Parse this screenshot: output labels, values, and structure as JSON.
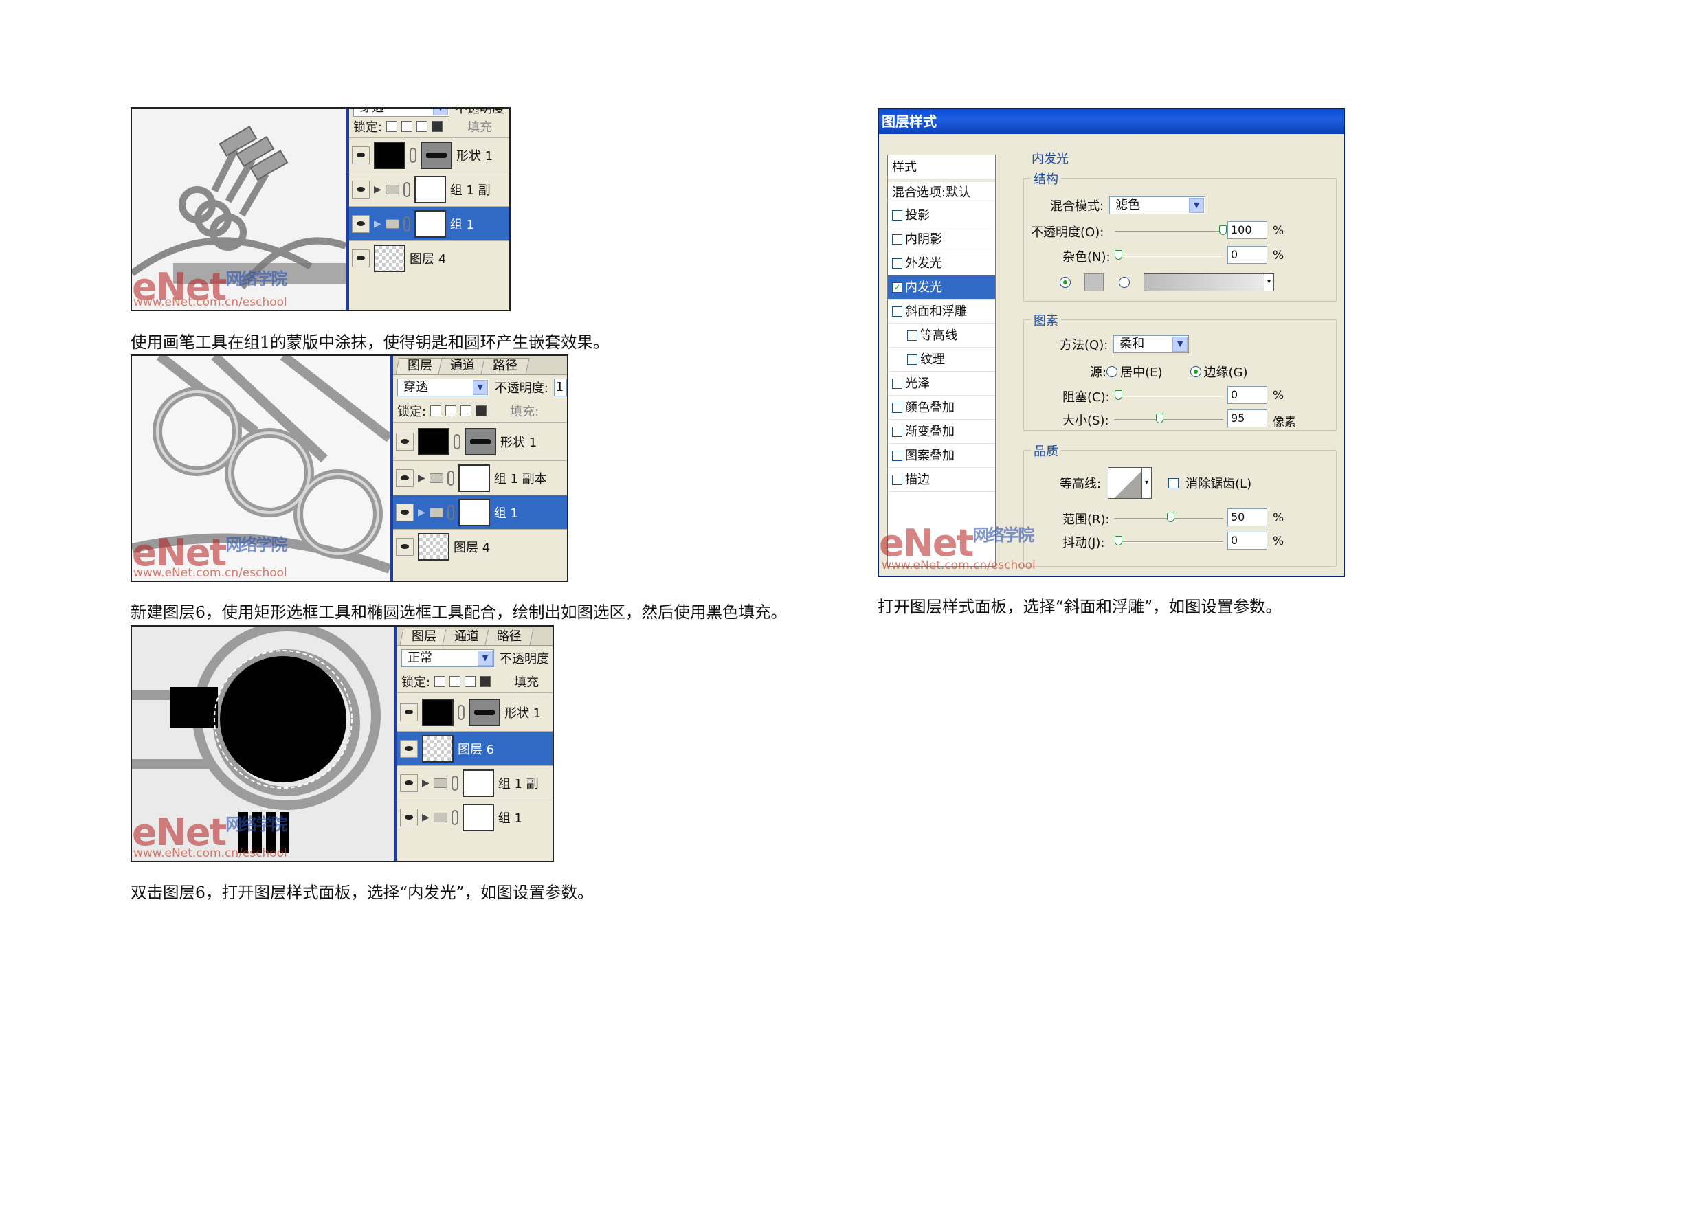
{
  "fig1": {
    "panel": {
      "blend_partial": "穿透",
      "opacity_partial": "不透明度",
      "lock_label": "锁定:",
      "fill_label": "填充",
      "layers": [
        "形状 1",
        "组 1 副",
        "组 1",
        "图层 4"
      ]
    }
  },
  "caption1": "使用画笔工具在组1的蒙版中涂抹，使得钥匙和圆环产生嵌套效果。",
  "fig2": {
    "tabs": [
      "图层",
      "通道",
      "路径"
    ],
    "blend": "穿透",
    "opacity_label": "不透明度:",
    "opacity_partial": "1",
    "lock_label": "锁定:",
    "fill_label": "填充:",
    "layers": [
      "形状 1",
      "组 1 副本",
      "组 1",
      "图层 4"
    ]
  },
  "caption2": "新建图层6，使用矩形选框工具和椭圆选框工具配合，绘制出如图选区，然后使用黑色填充。",
  "fig3": {
    "tabs": [
      "图层",
      "通道",
      "路径"
    ],
    "blend": "正常",
    "opacity_label": "不透明度",
    "lock_label": "锁定:",
    "fill_label": "填充",
    "layers": [
      "形状 1",
      "图层 6",
      "组 1 副",
      "组 1"
    ]
  },
  "caption3": "双击图层6，打开图层样式面板，选择“内发光”，如图设置参数。",
  "watermark": {
    "logo": "eNet",
    "cn": "网络学院",
    "domain": "com.cn",
    "url": "www.eNet.com.cn/eschool"
  },
  "dialog": {
    "title": "图层样式",
    "styles_header": "样式",
    "blend_options": "混合选项:默认",
    "styles": [
      {
        "label": "投影",
        "checked": false,
        "sub": false
      },
      {
        "label": "内阴影",
        "checked": false,
        "sub": false
      },
      {
        "label": "外发光",
        "checked": false,
        "sub": false
      },
      {
        "label": "内发光",
        "checked": true,
        "sub": false,
        "active": true
      },
      {
        "label": "斜面和浮雕",
        "checked": false,
        "sub": false
      },
      {
        "label": "等高线",
        "checked": false,
        "sub": true
      },
      {
        "label": "纹理",
        "checked": false,
        "sub": true
      },
      {
        "label": "光泽",
        "checked": false,
        "sub": false
      },
      {
        "label": "颜色叠加",
        "checked": false,
        "sub": false
      },
      {
        "label": "渐变叠加",
        "checked": false,
        "sub": false
      },
      {
        "label": "图案叠加",
        "checked": false,
        "sub": false
      },
      {
        "label": "描边",
        "checked": false,
        "sub": false
      }
    ],
    "section_title": "内发光",
    "structure": {
      "title": "结构",
      "blend_mode_label": "混合模式:",
      "blend_mode": "滤色",
      "opacity_label": "不透明度(O):",
      "opacity": "100",
      "noise_label": "杂色(N):",
      "noise": "0",
      "unit": "%"
    },
    "elements": {
      "title": "图素",
      "method_label": "方法(Q):",
      "method": "柔和",
      "source_label": "源:",
      "source_center": "居中(E)",
      "source_edge": "边缘(G)",
      "choke_label": "阻塞(C):",
      "choke": "0",
      "size_label": "大小(S):",
      "size": "95",
      "px_unit": "像素",
      "unit": "%"
    },
    "quality": {
      "title": "品质",
      "contour_label": "等高线:",
      "antialias_label": "消除锯齿(L)",
      "range_label": "范围(R):",
      "range": "50",
      "jitter_label": "抖动(J):",
      "jitter": "0",
      "unit": "%"
    }
  },
  "caption4": "打开图层样式面板，选择“斜面和浮雕”，如图设置参数。"
}
